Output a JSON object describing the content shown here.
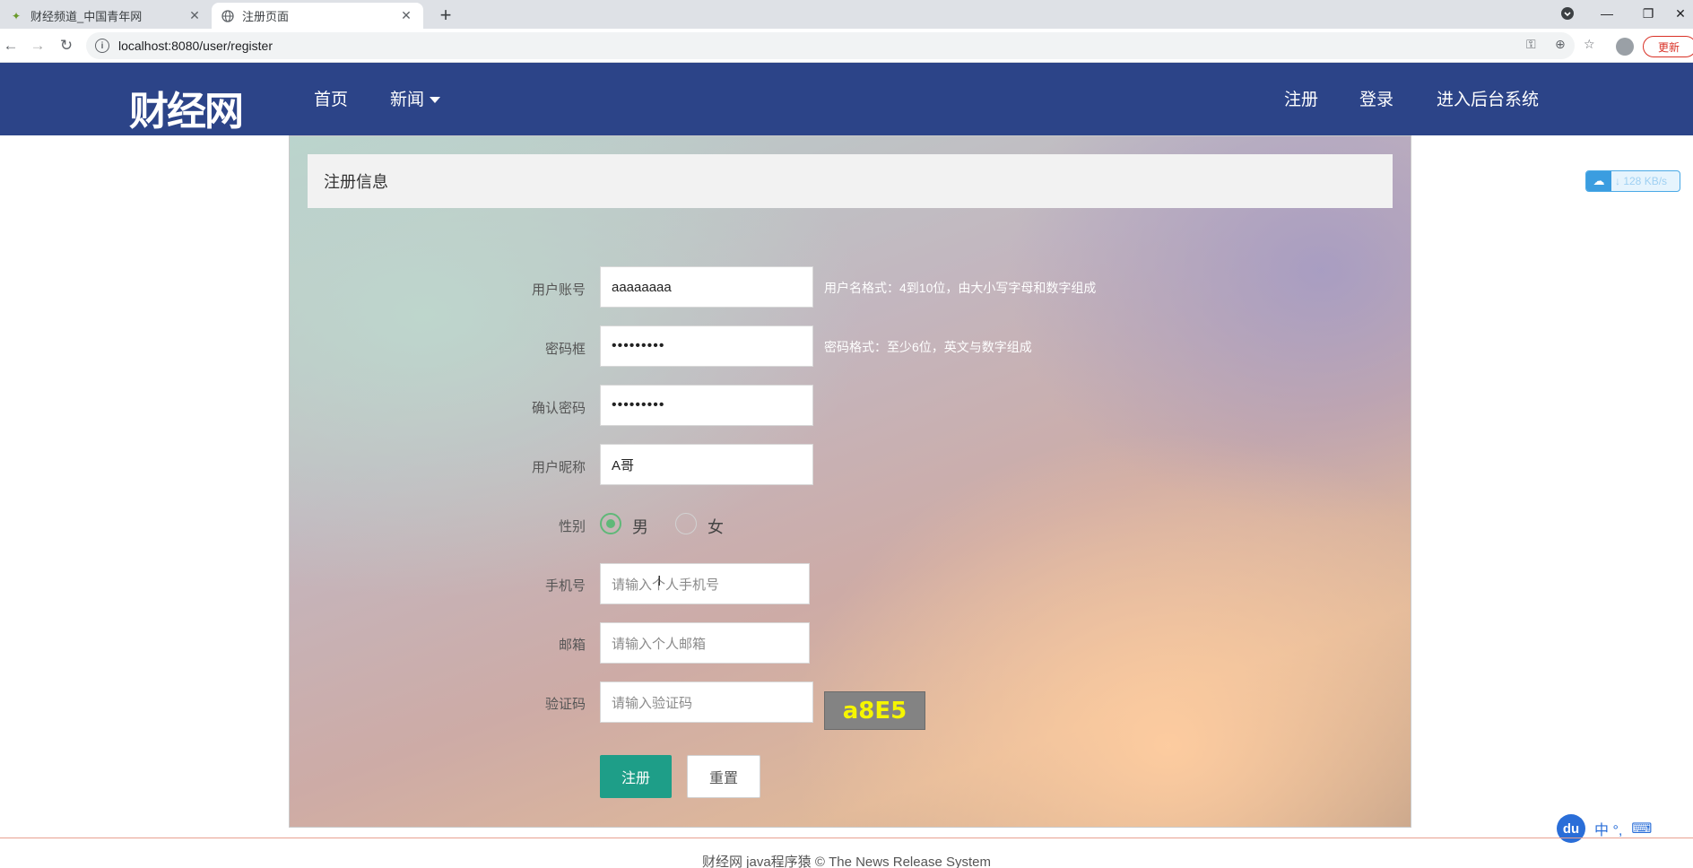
{
  "browser": {
    "tabs": [
      {
        "title": "财经频道_中国青年网",
        "active": false
      },
      {
        "title": "注册页面",
        "active": true
      }
    ],
    "url": "localhost:8080/user/register",
    "update_label": "更新"
  },
  "navbar": {
    "logo_text": "财经网",
    "links_left": [
      {
        "label": "首页"
      },
      {
        "label": "新闻"
      }
    ],
    "links_right": [
      {
        "label": "注册"
      },
      {
        "label": "登录"
      },
      {
        "label": "进入后台系统"
      }
    ]
  },
  "form": {
    "panel_title": "注册信息",
    "username": {
      "label": "用户账号",
      "value": "aaaaaaaa",
      "hint": "用户名格式：4到10位，由大小写字母和数字组成"
    },
    "password": {
      "label": "密码框",
      "value": "•••••••••",
      "hint": "密码格式：至少6位，英文与数字组成"
    },
    "confirm_password": {
      "label": "确认密码",
      "value": "•••••••••"
    },
    "nickname": {
      "label": "用户昵称",
      "value": "A哥"
    },
    "gender": {
      "label": "性别",
      "options": [
        "男",
        "女"
      ],
      "selected": "男"
    },
    "phone": {
      "label": "手机号",
      "placeholder": "请输入个人手机号"
    },
    "email": {
      "label": "邮箱",
      "placeholder": "请输入个人邮箱"
    },
    "captcha": {
      "label": "验证码",
      "placeholder": "请输入验证码",
      "code": "a8E5"
    },
    "submit_label": "注册",
    "reset_label": "重置"
  },
  "footer": {
    "text": "财经网 java程序猿 © The News Release System"
  },
  "widgets": {
    "speed": "↓ 128 KB/s",
    "ime_logo": "du",
    "ime_mode": "中 °,"
  },
  "colors": {
    "navbar": "#2c4488",
    "submit": "#1e9e88",
    "captcha_bg": "#838383",
    "captcha_text": "#f5f500",
    "radio_checked": "#5fb878"
  }
}
